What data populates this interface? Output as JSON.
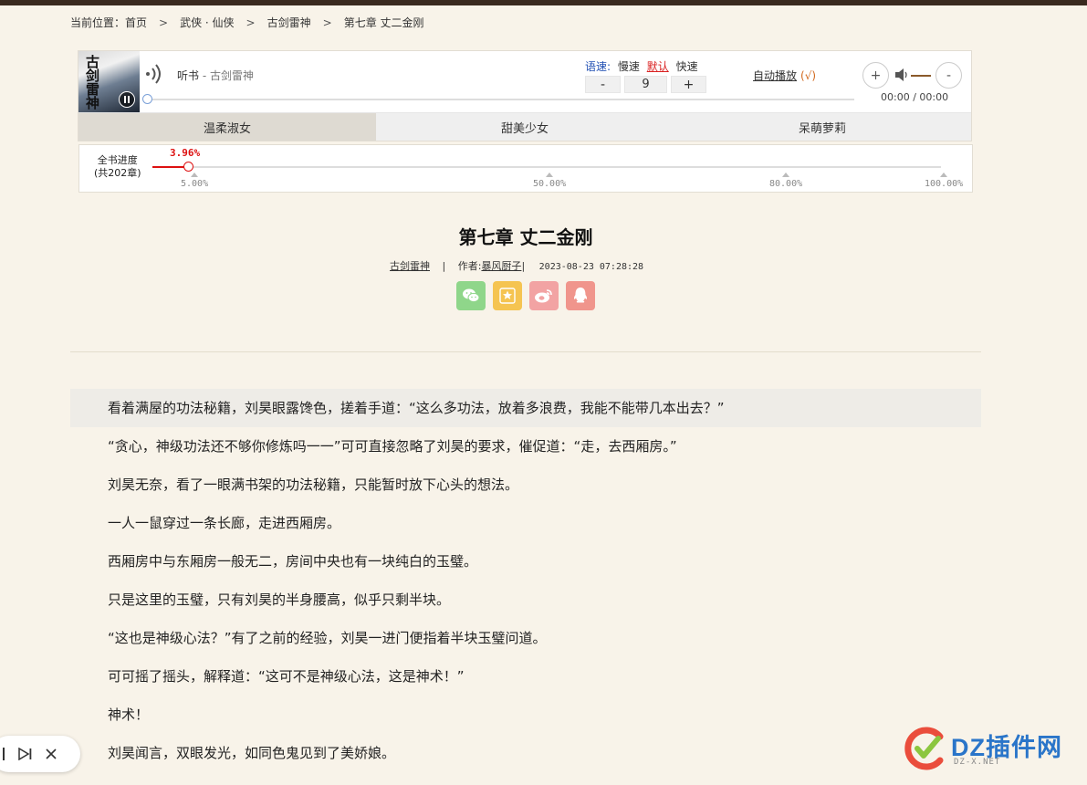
{
  "breadcrumb": {
    "label": "当前位置：",
    "items": [
      "首页",
      "武侠 · 仙侠",
      "古剑雷神",
      "第七章 丈二金刚"
    ],
    "separator": ">"
  },
  "player": {
    "cover_text": "古剑雷神",
    "title_prefix": "听书",
    "title_book": " - 古剑雷神",
    "speed_label": "语速:",
    "speed_slow": "慢速",
    "speed_default": "默认",
    "speed_fast": "快速",
    "minus_label": "-",
    "plus_label": "+",
    "speed_value": "9",
    "auto_play": "自动播放",
    "auto_check": "(√)",
    "vol_plus": "+",
    "vol_minus": "-",
    "time": "00:00 / 00:00",
    "voices": [
      "温柔淑女",
      "甜美少女",
      "呆萌萝莉"
    ],
    "active_voice": 0
  },
  "progress": {
    "label_line1": "全书进度",
    "label_line2": "(共202章)",
    "value_text": "3.96%",
    "value": 3.96,
    "marks": [
      "5.00%",
      "50.00%",
      "80.00%",
      "100.00%"
    ],
    "mark_values": [
      5,
      50,
      80,
      100
    ]
  },
  "chapter": {
    "title": "第七章 丈二金刚",
    "book": "古剑雷神",
    "separator": "|",
    "author_label": "作者:",
    "author": "暴风厨子",
    "date": "2023-08-23 07:28:28"
  },
  "share_icons": [
    "wechat-icon",
    "star-icon",
    "weibo-icon",
    "qq-icon"
  ],
  "colors": {
    "wechat": "#8fd68a",
    "star": "#f5c451",
    "weibo": "#f2a3a3",
    "qq": "#f0958c",
    "accent_red": "#d11111"
  },
  "paragraphs": [
    "看着满屋的功法秘籍，刘昊眼露馋色，搓着手道：“这么多功法，放着多浪费，我能不能带几本出去？”",
    "“贪心，神级功法还不够你修炼吗一一”可可直接忽略了刘昊的要求，催促道：“走，去西厢房。”",
    "刘昊无奈，看了一眼满书架的功法秘籍，只能暂时放下心头的想法。",
    "一人一鼠穿过一条长廊，走进西厢房。",
    "西厢房中与东厢房一般无二，房间中央也有一块纯白的玉璧。",
    "只是这里的玉璧，只有刘昊的半身腰高，似乎只剩半块。",
    "“这也是神级心法？”有了之前的经验，刘昊一进门便指着半块玉璧问道。",
    "可可摇了摇头，解释道：“这可不是神级心法，这是神术！”",
    "神术！",
    "刘昊闻言，双眼发光，如同色鬼见到了美娇娘。"
  ],
  "watermark": {
    "text": "DZ插件网",
    "sub": "DZ-X.NET"
  }
}
